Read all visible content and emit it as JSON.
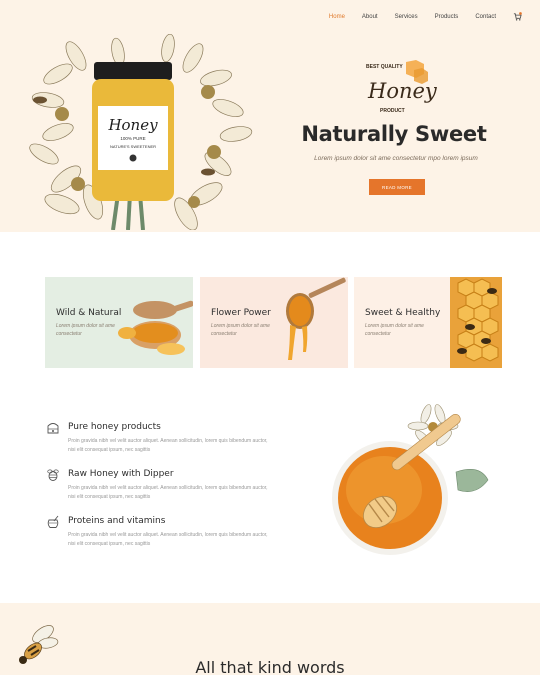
{
  "nav": {
    "items": [
      {
        "label": "Home",
        "active": true
      },
      {
        "label": "About",
        "active": false
      },
      {
        "label": "Services",
        "active": false
      },
      {
        "label": "Products",
        "active": false
      },
      {
        "label": "Contact",
        "active": false
      }
    ],
    "cart_icon": "cart-icon"
  },
  "hero": {
    "jar_brand": "Honey",
    "jar_line1": "100% PURE",
    "jar_line2": "NATURE'S SWEETENER",
    "logo_top": "BEST QUALITY",
    "logo_word": "Honey",
    "logo_bottom": "PRODUCT",
    "title": "Naturally Sweet",
    "subtitle": "Lorem ipsum dolor sit ame consectetur mpo lorem ipsum",
    "button": "READ MORE"
  },
  "cards": [
    {
      "title": "Wild & Natural",
      "text": "Lorem ipsum dolor sit ame consectetur",
      "icon": "honey-spoon-icon"
    },
    {
      "title": "Flower Power",
      "text": "Lorem ipsum dolor sit ame consectetur",
      "icon": "honey-dipper-icon"
    },
    {
      "title": "Sweet & Healthy",
      "text": "Lorem ipsum dolor sit ame consectetur",
      "icon": "honeycomb-bees-icon"
    }
  ],
  "benefits": [
    {
      "title": "Pure honey products",
      "text": "Proin gravida nibh vel velit auctor aliquet. Aenean sollicitudin, lorem quis bibendum auctor, nisi elit consequat ipsum, nec sagittis",
      "icon": "hive-icon"
    },
    {
      "title": "Raw Honey with Dipper",
      "text": "Proin gravida nibh vel velit auctor aliquet. Aenean sollicitudin, lorem quis bibendum auctor, nisi elit consequat ipsum, nec sagittis",
      "icon": "bee-icon"
    },
    {
      "title": "Proteins and vitamins",
      "text": "Proin gravida nibh vel velit auctor aliquet. Aenean sollicitudin, lorem quis bibendum auctor, nisi elit consequat ipsum, nec sagittis",
      "icon": "honey-pot-icon"
    }
  ],
  "testimonials": {
    "title": "All that kind words"
  },
  "colors": {
    "accent": "#e5752b",
    "hero_bg": "#fdf3e7",
    "card_green": "#e4eee3",
    "card_pink": "#fbe9df",
    "card_cream": "#fdf0e6"
  }
}
